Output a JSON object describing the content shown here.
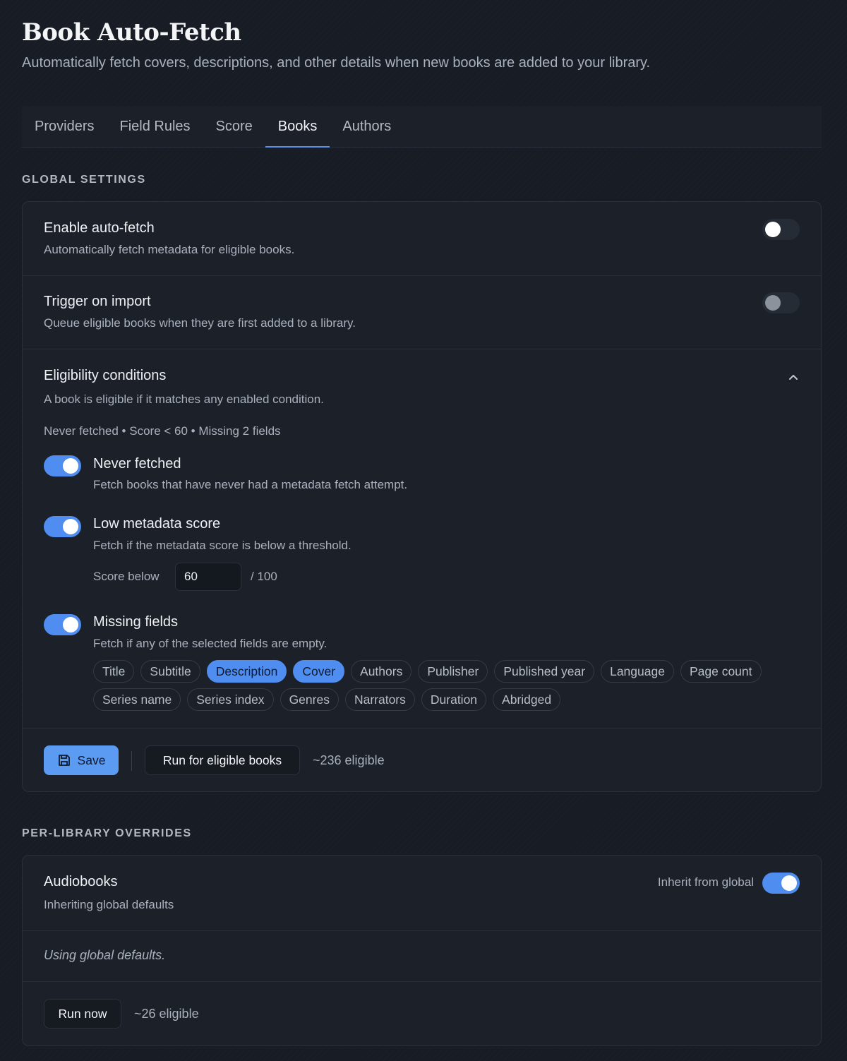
{
  "header": {
    "title": "Book Auto-Fetch",
    "subtitle": "Automatically fetch covers, descriptions, and other details when new books are added to your library."
  },
  "tabs": [
    {
      "label": "Providers",
      "active": false
    },
    {
      "label": "Field Rules",
      "active": false
    },
    {
      "label": "Score",
      "active": false
    },
    {
      "label": "Books",
      "active": true
    },
    {
      "label": "Authors",
      "active": false
    }
  ],
  "global": {
    "section_label": "GLOBAL SETTINGS",
    "enable": {
      "title": "Enable auto-fetch",
      "desc": "Automatically fetch metadata for eligible books.",
      "on": false
    },
    "trigger": {
      "title": "Trigger on import",
      "desc": "Queue eligible books when they are first added to a library.",
      "on": false
    },
    "eligibility": {
      "title": "Eligibility conditions",
      "desc": "A book is eligible if it matches any enabled condition.",
      "summary": "Never fetched • Score < 60 • Missing 2 fields",
      "never_fetched": {
        "title": "Never fetched",
        "desc": "Fetch books that have never had a metadata fetch attempt.",
        "on": true
      },
      "low_score": {
        "title": "Low metadata score",
        "desc": "Fetch if the metadata score is below a threshold.",
        "on": true,
        "score_label": "Score below",
        "score_value": "60",
        "score_max": "/ 100"
      },
      "missing_fields": {
        "title": "Missing fields",
        "desc": "Fetch if any of the selected fields are empty.",
        "on": true,
        "fields": [
          {
            "label": "Title",
            "selected": false
          },
          {
            "label": "Subtitle",
            "selected": false
          },
          {
            "label": "Description",
            "selected": true
          },
          {
            "label": "Cover",
            "selected": true
          },
          {
            "label": "Authors",
            "selected": false
          },
          {
            "label": "Publisher",
            "selected": false
          },
          {
            "label": "Published year",
            "selected": false
          },
          {
            "label": "Language",
            "selected": false
          },
          {
            "label": "Page count",
            "selected": false
          },
          {
            "label": "Series name",
            "selected": false
          },
          {
            "label": "Series index",
            "selected": false
          },
          {
            "label": "Genres",
            "selected": false
          },
          {
            "label": "Narrators",
            "selected": false
          },
          {
            "label": "Duration",
            "selected": false
          },
          {
            "label": "Abridged",
            "selected": false
          }
        ]
      }
    },
    "actions": {
      "save_label": "Save",
      "run_label": "Run for eligible books",
      "eligible_count": "~236 eligible"
    }
  },
  "overrides": {
    "section_label": "PER-LIBRARY OVERRIDES",
    "library": {
      "name": "Audiobooks",
      "status": "Inheriting global defaults",
      "inherit_label": "Inherit from global",
      "inherit_on": true,
      "note": "Using global defaults.",
      "run_label": "Run now",
      "eligible_count": "~26 eligible"
    }
  },
  "colors": {
    "accent": "#4f8ef0",
    "background": "#171c25",
    "card": "#1b2029"
  }
}
